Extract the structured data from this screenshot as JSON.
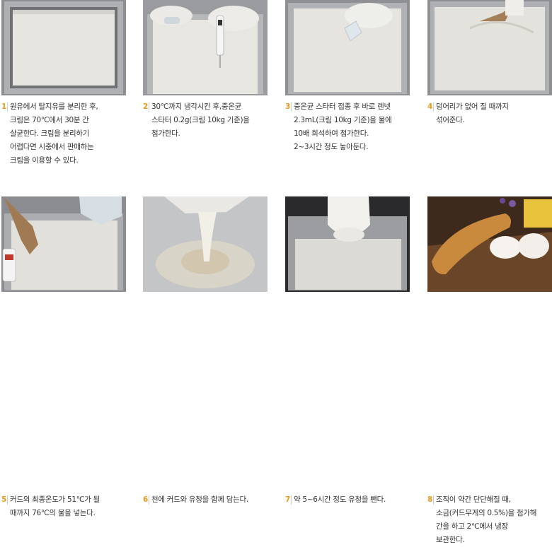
{
  "steps": [
    {
      "number": "1",
      "lines": [
        "원유에서 탈지유를 분리한 후,",
        "크림은 70℃에서 30분 간",
        "살균한다. 크림을 분리하기",
        "어렵다면 시중에서 판매하는",
        "크림을 이용할 수 있다."
      ]
    },
    {
      "number": "2",
      "lines": [
        "30℃까지 냉각시킨 후,중온균",
        "스타터 0.2g(크림 10kg 기준)을",
        "첨가한다."
      ]
    },
    {
      "number": "3",
      "lines": [
        "중온균 스타터 접종 후 바로  렌넷",
        "2.3mL(크림 10kg 기준)을 물에",
        "10배 희석하여 첨가한다.",
        "2~3시간 정도 놓아둔다."
      ]
    },
    {
      "number": "4",
      "lines": [
        "덩어리가 없어 질 때까지",
        "섞어준다."
      ]
    },
    {
      "number": "5",
      "lines": [
        "커드의 최종온도가 51℃가 될",
        "때까지 76℃의 물을 넣는다."
      ]
    },
    {
      "number": "6",
      "lines": [
        "천에 커드와 유청을 함께 담는다."
      ]
    },
    {
      "number": "7",
      "lines": [
        "약 5~6시간 정도 유청을 뺀다."
      ]
    },
    {
      "number": "8",
      "lines": [
        "조직이 약간 단단해질 때,",
        "소금(커드무게의 0.5%)을 첨가해",
        "간을 하고 2℃에서 냉장",
        "보관한다."
      ]
    }
  ],
  "colors": {
    "step_number": "#e89a1a",
    "text": "#333333",
    "divider": "#cfcfcf"
  }
}
